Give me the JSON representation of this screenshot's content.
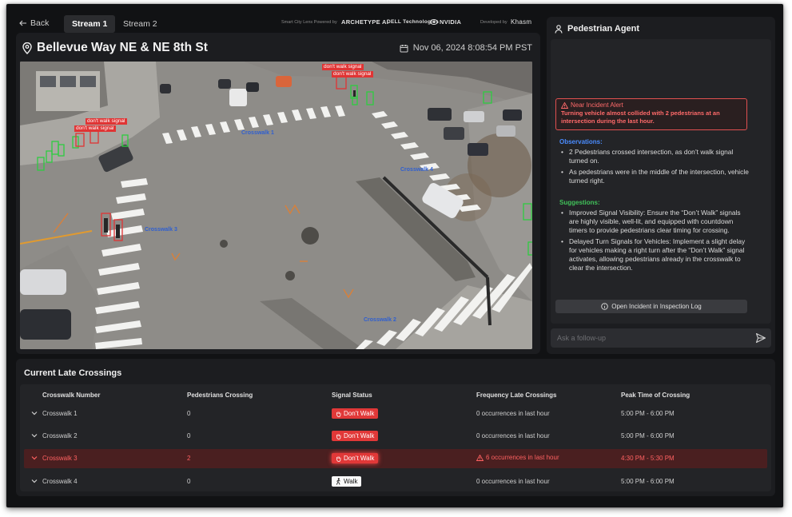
{
  "nav": {
    "back_label": "Back",
    "tabs": [
      {
        "label": "Stream 1",
        "active": true
      },
      {
        "label": "Stream 2",
        "active": false
      }
    ],
    "powered_by": "Smart City Lens Powered by",
    "brands": [
      "ARCHETYPE AI",
      "DELL Technologies",
      "NVIDIA"
    ],
    "developed_by": "Developed by",
    "developer": "Khasm"
  },
  "video": {
    "location": "Bellevue Way NE & NE 8th St",
    "timestamp": "Nov 06, 2024 8:08:54 PM PST",
    "crosswalk_labels": [
      "Crosswalk 1",
      "Crosswalk 2",
      "Crosswalk 3",
      "Crosswalk 4"
    ],
    "signal_label": "don't walk signal"
  },
  "agent": {
    "title": "Pedestrian Agent",
    "alert_title": "Near Incident Alert",
    "alert_text": "Turning vehicle almost collided with 2 pedestrians at an intersection during the last hour.",
    "observations_title": "Observations:",
    "observations": [
      "2 Pedestrians crossed intersection, as don’t walk signal turned on.",
      "As pedestrians were in the middle of the intersection,  vehicle turned right."
    ],
    "suggestions_title": "Suggestions:",
    "suggestions": [
      "Improved Signal Visibility: Ensure the “Don’t Walk” signals are highly visible, well-lit, and equipped with countdown timers to provide pedestrians clear timing for crossing.",
      "Delayed Turn Signals for Vehicles: Implement a slight delay for vehicles making a right turn after the “Don’t Walk” signal activates, allowing pedestrians already in the crosswalk to clear the intersection."
    ],
    "open_log_label": "Open Incident in Inspection Log",
    "followup_placeholder": "Ask a follow-up"
  },
  "crossings": {
    "title": "Current Late Crossings",
    "columns": [
      "Crosswalk Number",
      "Pedestrians Crossing",
      "Signal Status",
      "Frequency Late Crossings",
      "Peak Time of Crossing"
    ],
    "rows": [
      {
        "name": "Crosswalk 1",
        "pedestrians": "0",
        "signal": "Don’t Walk",
        "frequency": "0 occurrences in last hour",
        "peak": "5:00 PM - 6:00 PM",
        "alert": false
      },
      {
        "name": "Crosswalk 2",
        "pedestrians": "0",
        "signal": "Don’t Walk",
        "frequency": "0 occurrences in last hour",
        "peak": "5:00 PM - 6:00 PM",
        "alert": false
      },
      {
        "name": "Crosswalk 3",
        "pedestrians": "2",
        "signal": "Don’t Walk",
        "frequency": "6 occurrences in last hour",
        "peak": "4:30 PM - 5:30 PM",
        "alert": true
      },
      {
        "name": "Crosswalk 4",
        "pedestrians": "0",
        "signal": "Walk",
        "frequency": "0 occurrences in last hour",
        "peak": "5:00 PM - 6:00 PM",
        "alert": false
      }
    ]
  },
  "colors": {
    "background": "#111214",
    "panel": "#1c1d20",
    "alert_red": "#e13838",
    "observations_blue": "#4a8cff",
    "suggestions_green": "#41c25a",
    "crosswalk_label_blue": "#2f5fd0",
    "detection_green": "#2ecc40"
  },
  "icons": [
    "back-arrow-icon",
    "location-pin-icon",
    "calendar-icon",
    "person-icon",
    "warning-icon",
    "info-icon",
    "send-icon",
    "chevron-down-icon",
    "hand-icon",
    "walking-person-icon"
  ]
}
